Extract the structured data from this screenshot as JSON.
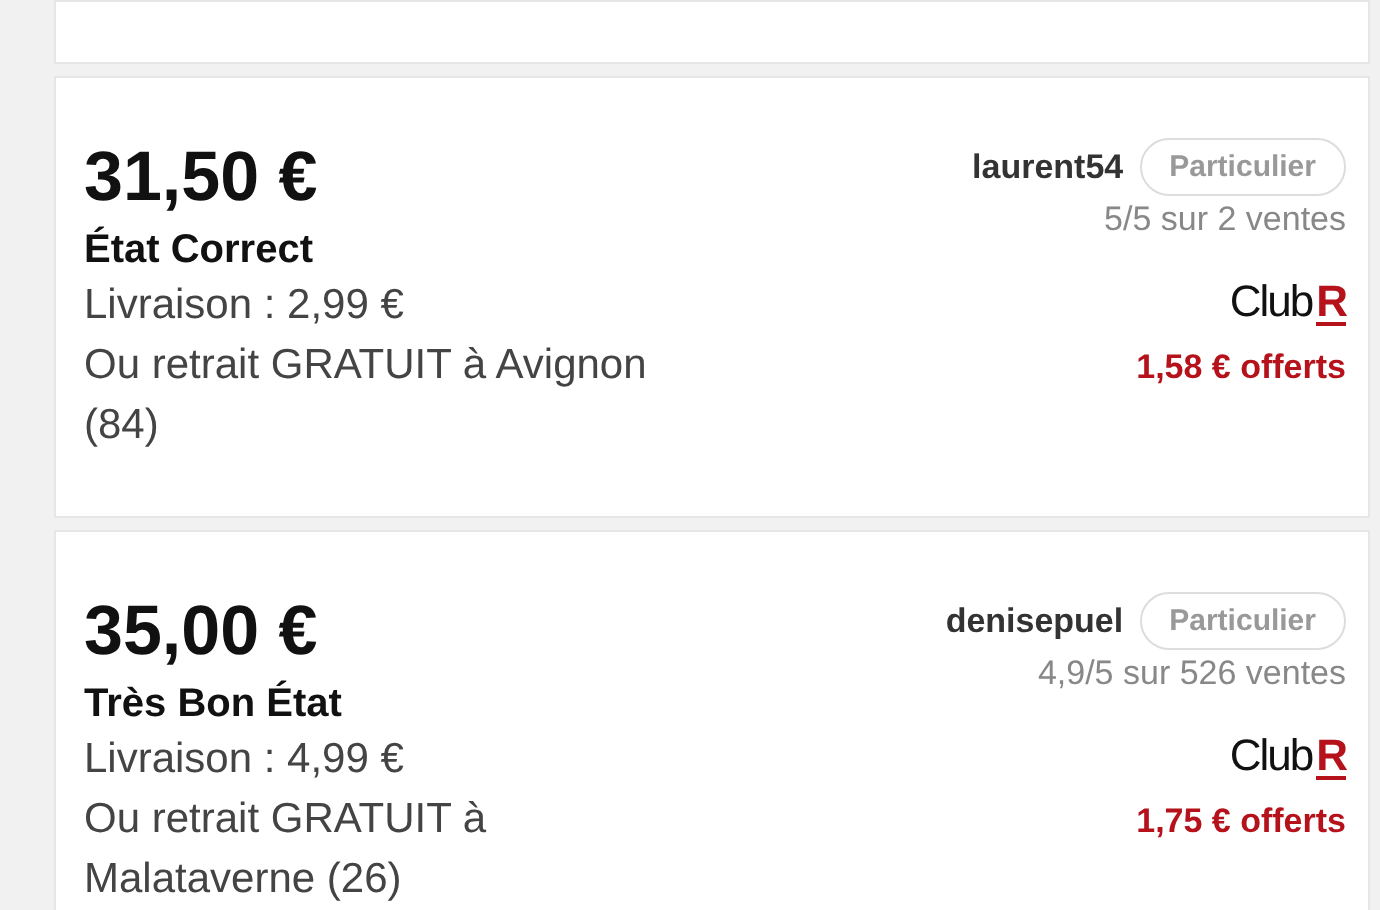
{
  "offers": [
    {
      "price": "31,50 €",
      "condition": "État Correct",
      "delivery": "Livraison : 2,99 €",
      "pickup": "Ou retrait GRATUIT à Avignon (84)",
      "seller": "laurent54",
      "badge": "Particulier",
      "rating": "5/5 sur 2 ventes",
      "club": {
        "word": "Club",
        "letter": "R"
      },
      "reward": "1,58 € offerts"
    },
    {
      "price": "35,00 €",
      "condition": "Très Bon État",
      "delivery": "Livraison : 4,99 €",
      "pickup": "Ou retrait GRATUIT à Malataverne (26)",
      "seller": "denisepuel",
      "badge": "Particulier",
      "rating": "4,9/5 sur 526 ventes",
      "club": {
        "word": "Club",
        "letter": "R"
      },
      "reward": "1,75 € offerts"
    }
  ]
}
